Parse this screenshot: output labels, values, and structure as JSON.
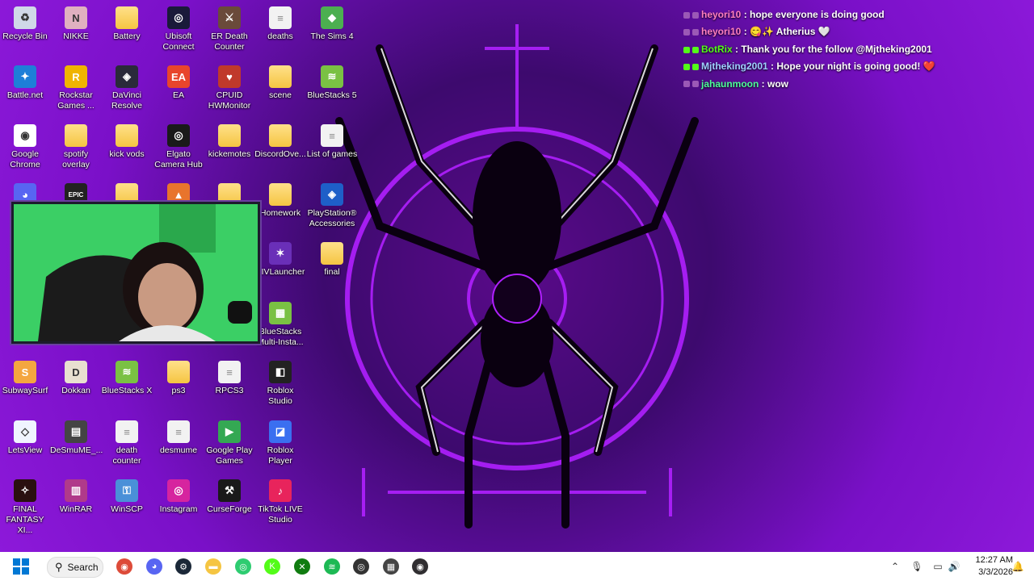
{
  "desktop": {
    "icons": [
      {
        "label": "Recycle Bin",
        "icon": "recycle-bin-icon",
        "color": "#d0d8e8",
        "glyph": "♻"
      },
      {
        "label": "NIKKE",
        "icon": "nikke-icon",
        "color": "#e0b0c0",
        "glyph": "N"
      },
      {
        "label": "Battery",
        "icon": "folder-icon",
        "color": "folder",
        "glyph": ""
      },
      {
        "label": "Ubisoft Connect",
        "icon": "ubisoft-icon",
        "color": "#1a1a3a",
        "glyph": "◎"
      },
      {
        "label": "ER Death Counter",
        "icon": "elden-ring-icon",
        "color": "#6a4a3a",
        "glyph": "⚔"
      },
      {
        "label": "deaths",
        "icon": "file-icon",
        "color": "file",
        "glyph": ""
      },
      {
        "label": "The Sims 4",
        "icon": "sims-icon",
        "color": "#4caf50",
        "glyph": "◆"
      },
      {
        "label": "Battle.net",
        "icon": "battlenet-icon",
        "color": "#1e7fd8",
        "glyph": "✦"
      },
      {
        "label": "Rockstar Games ...",
        "icon": "rockstar-icon",
        "color": "#f0b400",
        "glyph": "R"
      },
      {
        "label": "DaVinci Resolve",
        "icon": "davinci-icon",
        "color": "#2a2a3a",
        "glyph": "◈"
      },
      {
        "label": "EA",
        "icon": "ea-icon",
        "color": "#e8452c",
        "glyph": "EA"
      },
      {
        "label": "CPUID HWMonitor",
        "icon": "hwmonitor-icon",
        "color": "#c0392b",
        "glyph": "♥"
      },
      {
        "label": "scene",
        "icon": "folder-icon",
        "color": "folder",
        "glyph": ""
      },
      {
        "label": "BlueStacks 5",
        "icon": "bluestacks-icon",
        "color": "#7ac143",
        "glyph": "≋"
      },
      {
        "label": "Google Chrome",
        "icon": "chrome-icon",
        "color": "#ffffff",
        "glyph": "◉"
      },
      {
        "label": "spotify overlay",
        "icon": "folder-icon",
        "color": "folder",
        "glyph": ""
      },
      {
        "label": "kick vods",
        "icon": "folder-icon",
        "color": "folder",
        "glyph": ""
      },
      {
        "label": "Elgato Camera Hub",
        "icon": "elgato-icon",
        "color": "#1a1a1a",
        "glyph": "◎"
      },
      {
        "label": "kickemotes",
        "icon": "folder-icon",
        "color": "folder",
        "glyph": ""
      },
      {
        "label": "DiscordOve...",
        "icon": "folder-icon",
        "color": "folder",
        "glyph": ""
      },
      {
        "label": "List of games",
        "icon": "file-icon",
        "color": "file",
        "glyph": ""
      },
      {
        "label": "",
        "icon": "discord-icon",
        "color": "#5865f2",
        "glyph": "◕"
      },
      {
        "label": "",
        "icon": "epic-games-icon",
        "color": "#222222",
        "glyph": "EPIC"
      },
      {
        "label": "",
        "icon": "folder-icon",
        "color": "folder",
        "glyph": ""
      },
      {
        "label": "",
        "icon": "app-icon",
        "color": "#e8742c",
        "glyph": "▲"
      },
      {
        "label": "",
        "icon": "folder-icon",
        "color": "folder",
        "glyph": ""
      },
      {
        "label": "Homework",
        "icon": "folder-icon",
        "color": "folder",
        "glyph": ""
      },
      {
        "label": "PlayStation® Accessories",
        "icon": "playstation-icon",
        "color": "#1e5fc8",
        "glyph": "◈"
      },
      {
        "label": "XIVLauncher",
        "icon": "xivlauncher-icon",
        "color": "#6a2fb8",
        "glyph": "✶"
      },
      {
        "label": "final",
        "icon": "folder-icon",
        "color": "folder",
        "glyph": ""
      },
      {
        "label": "BlueStacks Multi-Insta...",
        "icon": "bluestacks-multi-icon",
        "color": "#7ac143",
        "glyph": "▦"
      },
      {
        "label": "SubwaySurf",
        "icon": "subway-surf-icon",
        "color": "#f4a640",
        "glyph": "S"
      },
      {
        "label": "Dokkan",
        "icon": "dokkan-icon",
        "color": "#e8e0d0",
        "glyph": "D"
      },
      {
        "label": "BlueStacks X",
        "icon": "bluestacks-x-icon",
        "color": "#7ac143",
        "glyph": "≋"
      },
      {
        "label": "ps3",
        "icon": "folder-icon",
        "color": "folder",
        "glyph": ""
      },
      {
        "label": "RPCS3",
        "icon": "file-icon",
        "color": "file",
        "glyph": ""
      },
      {
        "label": "Roblox Studio",
        "icon": "roblox-studio-icon",
        "color": "#222222",
        "glyph": "◧"
      },
      {
        "label": "LetsView",
        "icon": "letsview-icon",
        "color": "#f0f4ff",
        "glyph": "◇"
      },
      {
        "label": "DeSmuME_...",
        "icon": "desmume-icon",
        "color": "#444444",
        "glyph": "▤"
      },
      {
        "label": "death counter",
        "icon": "file-icon",
        "color": "file",
        "glyph": ""
      },
      {
        "label": "desmume",
        "icon": "file-icon",
        "color": "file",
        "glyph": ""
      },
      {
        "label": "Google Play Games",
        "icon": "google-play-games-icon",
        "color": "#34a853",
        "glyph": "▶"
      },
      {
        "label": "Roblox Player",
        "icon": "roblox-player-icon",
        "color": "#3a6ff0",
        "glyph": "◪"
      },
      {
        "label": "FINAL FANTASY XI...",
        "icon": "final-fantasy-icon",
        "color": "#2a1010",
        "glyph": "✧"
      },
      {
        "label": "WinRAR",
        "icon": "winrar-icon",
        "color": "#b03a8a",
        "glyph": "▥"
      },
      {
        "label": "WinSCP",
        "icon": "winscp-icon",
        "color": "#4a90d8",
        "glyph": "⚿"
      },
      {
        "label": "Instagram",
        "icon": "instagram-icon",
        "color": "#d6249f",
        "glyph": "◎"
      },
      {
        "label": "CurseForge",
        "icon": "curseforge-icon",
        "color": "#1a1a1a",
        "glyph": "⚒"
      },
      {
        "label": "TikTok LIVE Studio",
        "icon": "tiktok-live-icon",
        "color": "#e8245c",
        "glyph": "♪"
      }
    ]
  },
  "chat": {
    "messages": [
      {
        "user": "heyori10",
        "user_color": "#ff7fbf",
        "text": ": hope everyone is doing good",
        "badge_color": "#9b59b6"
      },
      {
        "user": "heyori10",
        "user_color": "#ff7fbf",
        "text": ": 😋✨ Atherius 🤍",
        "badge_color": "#9b59b6"
      },
      {
        "user": "BotRix",
        "user_color": "#53fc18",
        "text": ": Thank you for the follow @Mjtheking2001",
        "badge_color": "#53fc18"
      },
      {
        "user": "Mjtheking2001",
        "user_color": "#9fd0ff",
        "text": ": Hope your night is going good! ❤️",
        "badge_color": "#53fc18"
      },
      {
        "user": "jahaunmoon",
        "user_color": "#4cff9a",
        "text": ": wow",
        "badge_color": "#9b59b6"
      }
    ]
  },
  "taskbar": {
    "search_label": "Search",
    "apps": [
      {
        "name": "chrome-icon",
        "color": "#dd4b39",
        "glyph": "◉"
      },
      {
        "name": "discord-icon",
        "color": "#5865f2",
        "glyph": "◕"
      },
      {
        "name": "steam-icon",
        "color": "#1b2838",
        "glyph": "⚙"
      },
      {
        "name": "file-explorer-icon",
        "color": "#f5c542",
        "glyph": "▬"
      },
      {
        "name": "app-green-icon",
        "color": "#2ecc71",
        "glyph": "◎"
      },
      {
        "name": "kick-icon",
        "color": "#53fc18",
        "glyph": "K"
      },
      {
        "name": "xbox-icon",
        "color": "#107c10",
        "glyph": "✕"
      },
      {
        "name": "spotify-icon",
        "color": "#1db954",
        "glyph": "≋"
      },
      {
        "name": "elgato-icon",
        "color": "#333333",
        "glyph": "◎"
      },
      {
        "name": "calculator-icon",
        "color": "#444444",
        "glyph": "▦"
      },
      {
        "name": "obs-icon",
        "color": "#302e31",
        "glyph": "◉"
      }
    ],
    "time": "12:27 AM",
    "date": "3/3/2026"
  }
}
